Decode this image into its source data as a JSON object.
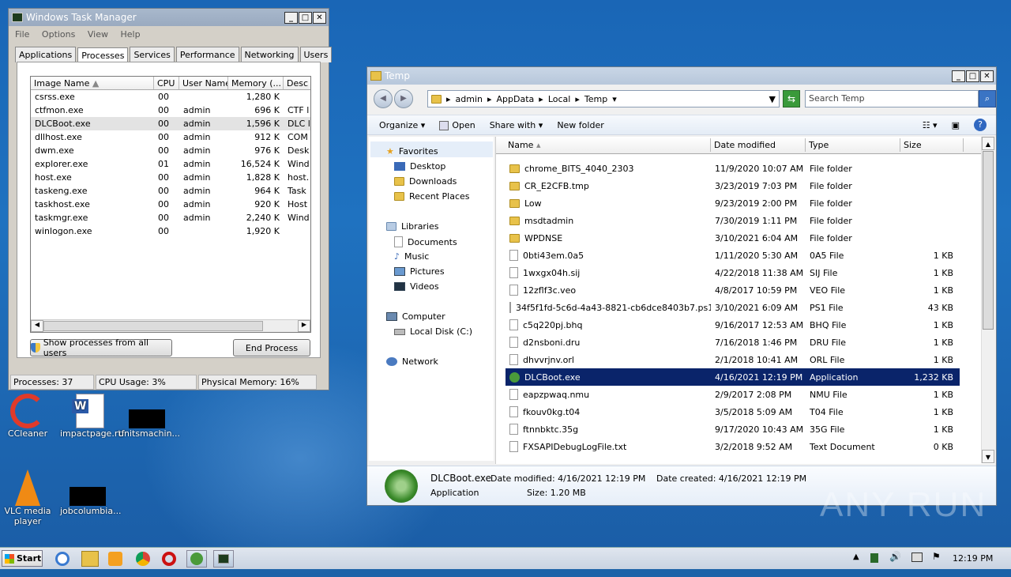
{
  "taskmgr": {
    "title": "Windows Task Manager",
    "menu": [
      "File",
      "Options",
      "View",
      "Help"
    ],
    "tabs": [
      "Applications",
      "Processes",
      "Services",
      "Performance",
      "Networking",
      "Users"
    ],
    "columns": [
      "Image Name",
      "CPU",
      "User Name",
      "Memory (...",
      "Desc"
    ],
    "rows": [
      [
        "csrss.exe",
        "00",
        "",
        "1,280 K",
        ""
      ],
      [
        "ctfmon.exe",
        "00",
        "admin",
        "696 K",
        "CTF l"
      ],
      [
        "DLCBoot.exe",
        "00",
        "admin",
        "1,596 K",
        "DLC l"
      ],
      [
        "dllhost.exe",
        "00",
        "admin",
        "912 K",
        "COM"
      ],
      [
        "dwm.exe",
        "00",
        "admin",
        "976 K",
        "Desk"
      ],
      [
        "explorer.exe",
        "01",
        "admin",
        "16,524 K",
        "Wind"
      ],
      [
        "host.exe",
        "00",
        "admin",
        "1,828 K",
        "host."
      ],
      [
        "taskeng.exe",
        "00",
        "admin",
        "964 K",
        "Task"
      ],
      [
        "taskhost.exe",
        "00",
        "admin",
        "920 K",
        "Host"
      ],
      [
        "taskmgr.exe",
        "00",
        "admin",
        "2,240 K",
        "Wind"
      ],
      [
        "winlogon.exe",
        "00",
        "",
        "1,920 K",
        ""
      ]
    ],
    "show_all_label": "Show processes from all users",
    "end_process_label": "End Process",
    "status": {
      "processes": "Processes: 37",
      "cpu": "CPU Usage: 3%",
      "memory": "Physical Memory: 16%"
    }
  },
  "explorer": {
    "title": "Temp",
    "breadcrumb": [
      "admin",
      "AppData",
      "Local",
      "Temp"
    ],
    "search_placeholder": "Search Temp",
    "toolbar": [
      "Organize",
      "Open",
      "Share with",
      "New folder"
    ],
    "nav": {
      "favorites": "Favorites",
      "desktop": "Desktop",
      "downloads": "Downloads",
      "recent": "Recent Places",
      "libraries": "Libraries",
      "documents": "Documents",
      "music": "Music",
      "pictures": "Pictures",
      "videos": "Videos",
      "computer": "Computer",
      "localdisk": "Local Disk (C:)",
      "network": "Network"
    },
    "columns": [
      "Name",
      "Date modified",
      "Type",
      "Size"
    ],
    "files": [
      [
        "chrome_BITS_4040_2303",
        "11/9/2020 10:07 AM",
        "File folder",
        ""
      ],
      [
        "CR_E2CFB.tmp",
        "3/23/2019 7:03 PM",
        "File folder",
        ""
      ],
      [
        "Low",
        "9/23/2019 2:00 PM",
        "File folder",
        ""
      ],
      [
        "msdtadmin",
        "7/30/2019 1:11 PM",
        "File folder",
        ""
      ],
      [
        "WPDNSE",
        "3/10/2021 6:04 AM",
        "File folder",
        ""
      ],
      [
        "0bti43em.0a5",
        "1/11/2020 5:30 AM",
        "0A5 File",
        "1 KB"
      ],
      [
        "1wxgx04h.sij",
        "4/22/2018 11:38 AM",
        "SIJ File",
        "1 KB"
      ],
      [
        "12zflf3c.veo",
        "4/8/2017 10:59 PM",
        "VEO File",
        "1 KB"
      ],
      [
        "34f5f1fd-5c6d-4a43-8821-cb6dce8403b7.ps1",
        "3/10/2021 6:09 AM",
        "PS1 File",
        "43 KB"
      ],
      [
        "c5q220pj.bhq",
        "9/16/2017 12:53 AM",
        "BHQ File",
        "1 KB"
      ],
      [
        "d2nsboni.dru",
        "7/16/2018 1:46 PM",
        "DRU File",
        "1 KB"
      ],
      [
        "dhvvrjnv.orl",
        "2/1/2018 10:41 AM",
        "ORL File",
        "1 KB"
      ],
      [
        "DLCBoot.exe",
        "4/16/2021 12:19 PM",
        "Application",
        "1,232 KB"
      ],
      [
        "eapzpwaq.nmu",
        "2/9/2017 2:08 PM",
        "NMU File",
        "1 KB"
      ],
      [
        "fkouv0kg.t04",
        "3/5/2018 5:09 AM",
        "T04 File",
        "1 KB"
      ],
      [
        "ftnnbktc.35g",
        "9/17/2020 10:43 AM",
        "35G File",
        "1 KB"
      ],
      [
        "FXSAPIDebugLogFile.txt",
        "3/2/2018 9:52 AM",
        "Text Document",
        "0 KB"
      ]
    ],
    "details": {
      "name": "DLCBoot.exe",
      "modified_label": "Date modified:",
      "modified": "4/16/2021 12:19 PM",
      "created_label": "Date created:",
      "created": "4/16/2021 12:19 PM",
      "type": "Application",
      "size_label": "Size:",
      "size": "1.20 MB"
    }
  },
  "desktop_icons": [
    "CCleaner",
    "impactpage.rtf",
    "unitsmachin...",
    "VLC media player",
    "jobcolumbia..."
  ],
  "taskbar": {
    "start": "Start",
    "clock": "12:19 PM"
  },
  "watermark": "ANY RUN"
}
